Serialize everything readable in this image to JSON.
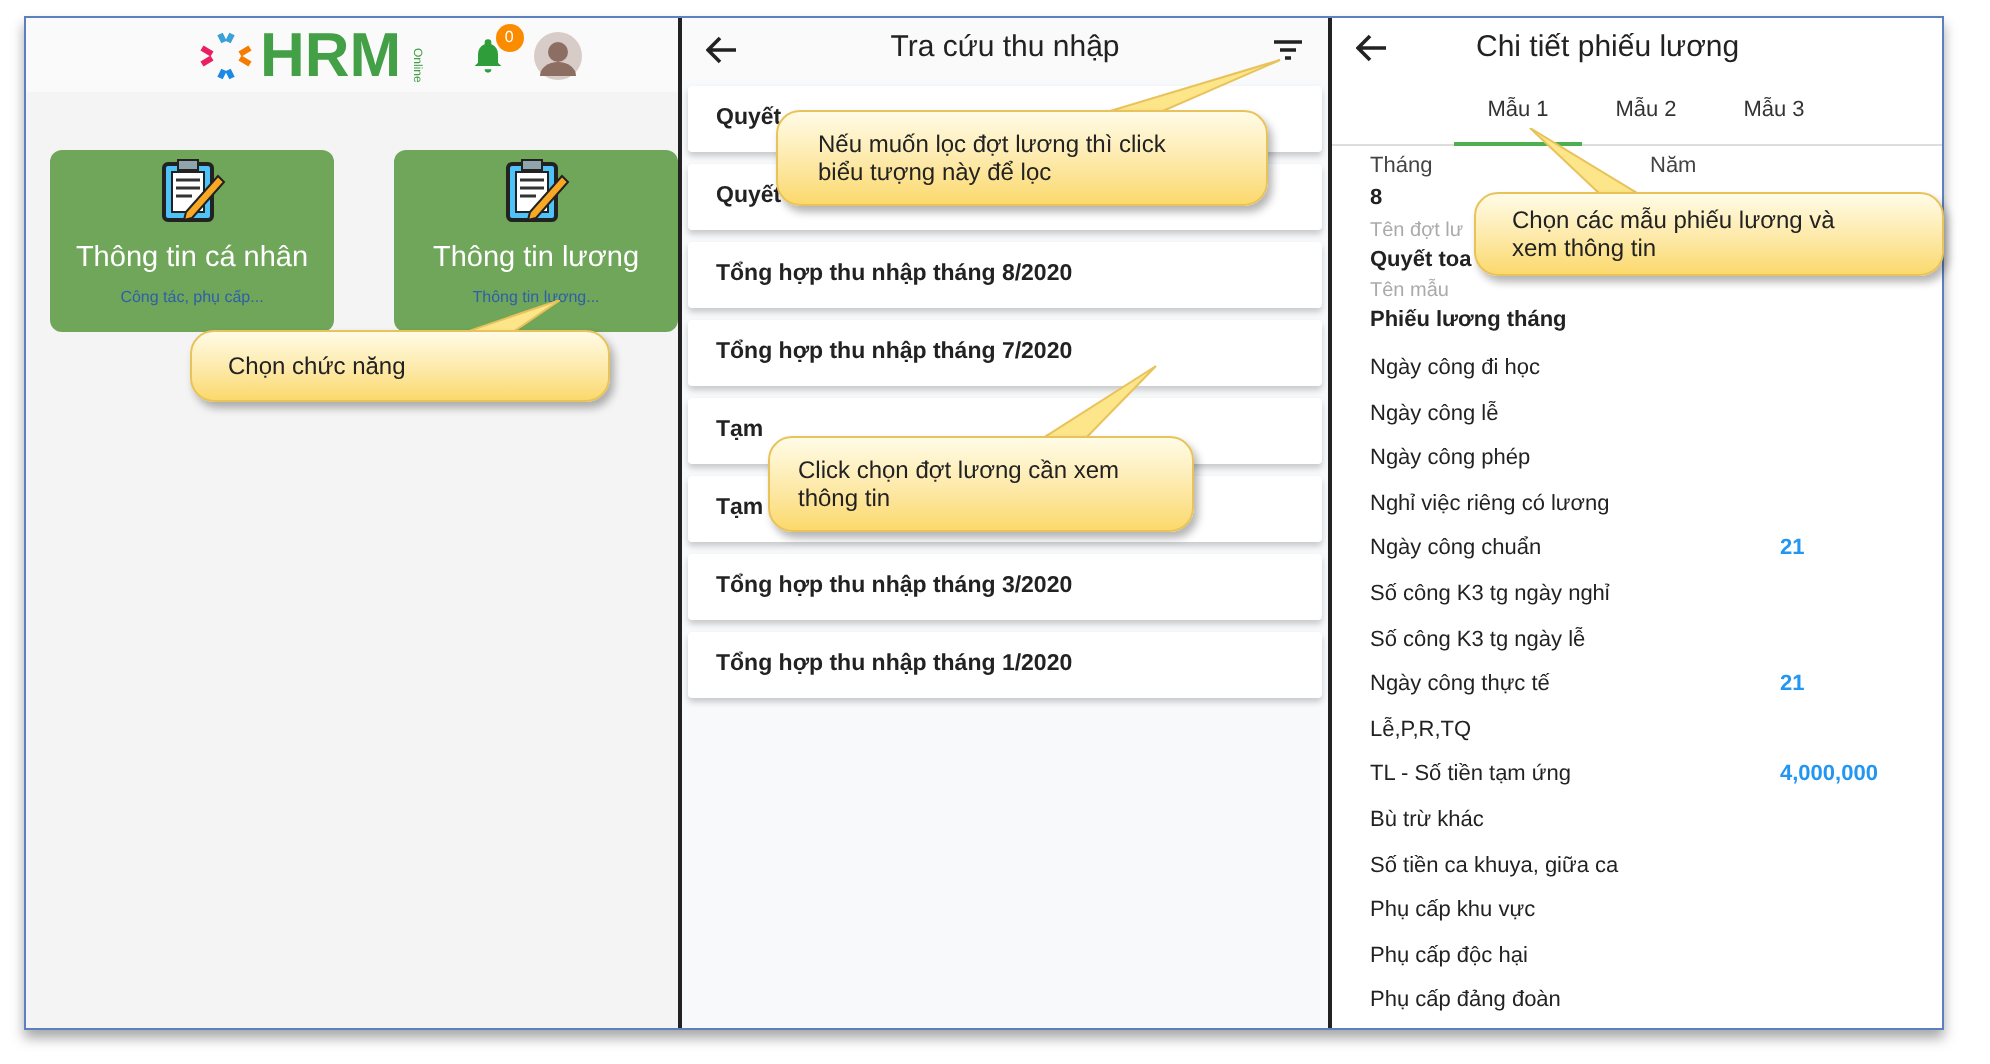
{
  "home": {
    "logo": {
      "brand": "HRM",
      "tag": "Online"
    },
    "notification_count": "0",
    "cards": [
      {
        "title": "Thông tin cá nhân",
        "subtitle": "Công tác, phụ cấp..."
      },
      {
        "title": "Thông tin lương",
        "subtitle": "Thông tin lương..."
      }
    ]
  },
  "income_lookup": {
    "title": "Tra cứu thu nhập",
    "items": [
      "Quyết",
      "Quyết",
      "Tổng hợp thu nhập tháng 8/2020",
      "Tổng hợp thu nhập tháng 7/2020",
      "Tạm",
      "Tạm",
      "Tổng hợp thu nhập tháng 3/2020",
      "Tổng hợp thu nhập tháng 1/2020"
    ]
  },
  "payslip": {
    "title": "Chi tiết phiếu lương",
    "tabs": [
      {
        "label": "Mẫu 1",
        "selected": true
      },
      {
        "label": "Mẫu 2",
        "selected": false
      },
      {
        "label": "Mẫu 3",
        "selected": false
      }
    ],
    "month_label": "Tháng",
    "year_label": "Năm",
    "month_value": "8",
    "batch_label": "Tên đợt lư",
    "batch_value": "Quyết toa",
    "template_label": "Tên mẫu",
    "template_value": "Phiếu lương tháng",
    "rows": [
      {
        "label": "Ngày công đi học"
      },
      {
        "label": "Ngày công lễ"
      },
      {
        "label": "Ngày công phép"
      },
      {
        "label": "Nghỉ việc riêng có lương"
      },
      {
        "label": "Ngày công chuẩn",
        "value": "21"
      },
      {
        "label": "Số công K3 tg ngày nghỉ"
      },
      {
        "label": "Số công K3 tg ngày lễ"
      },
      {
        "label": "Ngày công thực tế",
        "value": "21"
      },
      {
        "label": "Lễ,P,R,TQ"
      },
      {
        "label": "TL - Số tiền tạm ứng",
        "value": "4,000,000"
      },
      {
        "label": "Bù trừ khác"
      },
      {
        "label": "Số tiền ca khuya, giữa ca"
      },
      {
        "label": "Phụ cấp khu vực"
      },
      {
        "label": "Phụ cấp độc hại"
      },
      {
        "label": "Phụ cấp đảng đoàn"
      }
    ]
  },
  "callouts": [
    {
      "text": "Chọn chức năng"
    },
    {
      "text": "Nếu muốn lọc đợt lương thì click biểu tượng này để lọc"
    },
    {
      "text": "Click chọn đợt lương cần xem thông tin"
    },
    {
      "text": "Chọn các mẫu phiếu lương và xem thông tin"
    }
  ]
}
